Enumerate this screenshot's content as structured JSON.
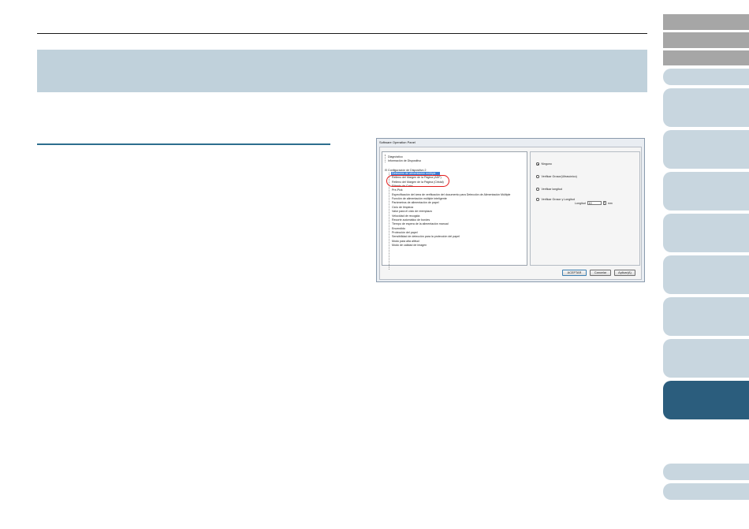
{
  "dialog": {
    "title": "Software Operation Panel",
    "tree": {
      "diagnostics": "Diagnóstico",
      "device_info": "Información de Dispositivo",
      "device_settings_2": "Configuración de Dispositivo 2",
      "items": [
        "Detección de alimentación múltiple",
        "Relleno del Margen de la Página (ADF)",
        "Relleno del Margen de la Página (Cristal)",
        "Filtrado de Color",
        "Pre-Pick",
        "Especificación del área de verificación del documento para Detección de Alimentación Múltiple",
        "Función de alimentación múltiple inteligente",
        "Parámetros de alimentación de papel",
        "Ciclo de limpieza",
        "Valor para el ciclo de reemplazo",
        "Velocidad de recogida",
        "Recorte automático de bordes",
        "Tiempo de espera de la alimentación manual",
        "Encendido",
        "Protección del papel",
        "Sensibilidad de detección para la protección del papel",
        "Modo para alta altitud",
        "Modo de calidad de imagen"
      ]
    },
    "options": [
      {
        "label": "Ninguno",
        "selected": true
      },
      {
        "label": "Verificar Grosor(Ultrasónico)",
        "selected": false
      },
      {
        "label": "Verificar longitud",
        "selected": false
      },
      {
        "label": "Verificar Grosor y Longitud",
        "selected": false
      }
    ],
    "length_label": "Longitud",
    "length_value": "10",
    "length_unit": "mm",
    "buttons": {
      "ok": "ACEPTAR",
      "cancel": "Cancelar",
      "apply": "Aplicar(A)"
    }
  },
  "colors": {
    "title_band": "#c0d1db",
    "active_tab": "#2b5d7d",
    "inactive_tab": "#c8d6df",
    "highlight_ring": "#e21b1b"
  }
}
